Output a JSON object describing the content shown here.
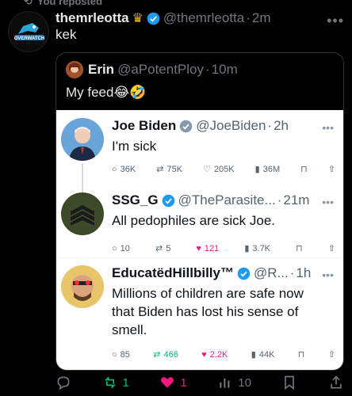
{
  "repost": {
    "label": "You reposted"
  },
  "outer": {
    "name": "themrleotta",
    "handle": "@themrleotta",
    "time": "2m",
    "text": "kek"
  },
  "quote": {
    "name": "Erin",
    "handle": "@aPotentPloy",
    "time": "10m",
    "text": "My feed😂🤣"
  },
  "screenshot": {
    "tweets": [
      {
        "name": "Joe Biden",
        "handle": "@JoeBiden",
        "time": "2h",
        "text": "I'm sick",
        "replies": "36K",
        "reposts": "75K",
        "likes": "205K",
        "views": "36M"
      },
      {
        "name": "SSG_G",
        "handle": "@TheParasite...",
        "time": "21m",
        "text": "All pedophiles are sick Joe.",
        "replies": "10",
        "reposts": "5",
        "likes": "121",
        "views": "3.7K"
      },
      {
        "name": "EducatëdHillbilly™",
        "handle": "@R...",
        "time": "1h",
        "text_lines": [
          "Millions of children are safe now",
          "that Biden has lost his sense of",
          "smell."
        ],
        "replies": "85",
        "reposts": "466",
        "likes": "2.2K",
        "views": "44K"
      }
    ]
  },
  "actions": {
    "reposts": "1",
    "likes": "1",
    "views": "10"
  },
  "colors": {
    "verified": "#1d9bf0",
    "repost_active": "#00ba7c",
    "like_active": "#f91880"
  }
}
